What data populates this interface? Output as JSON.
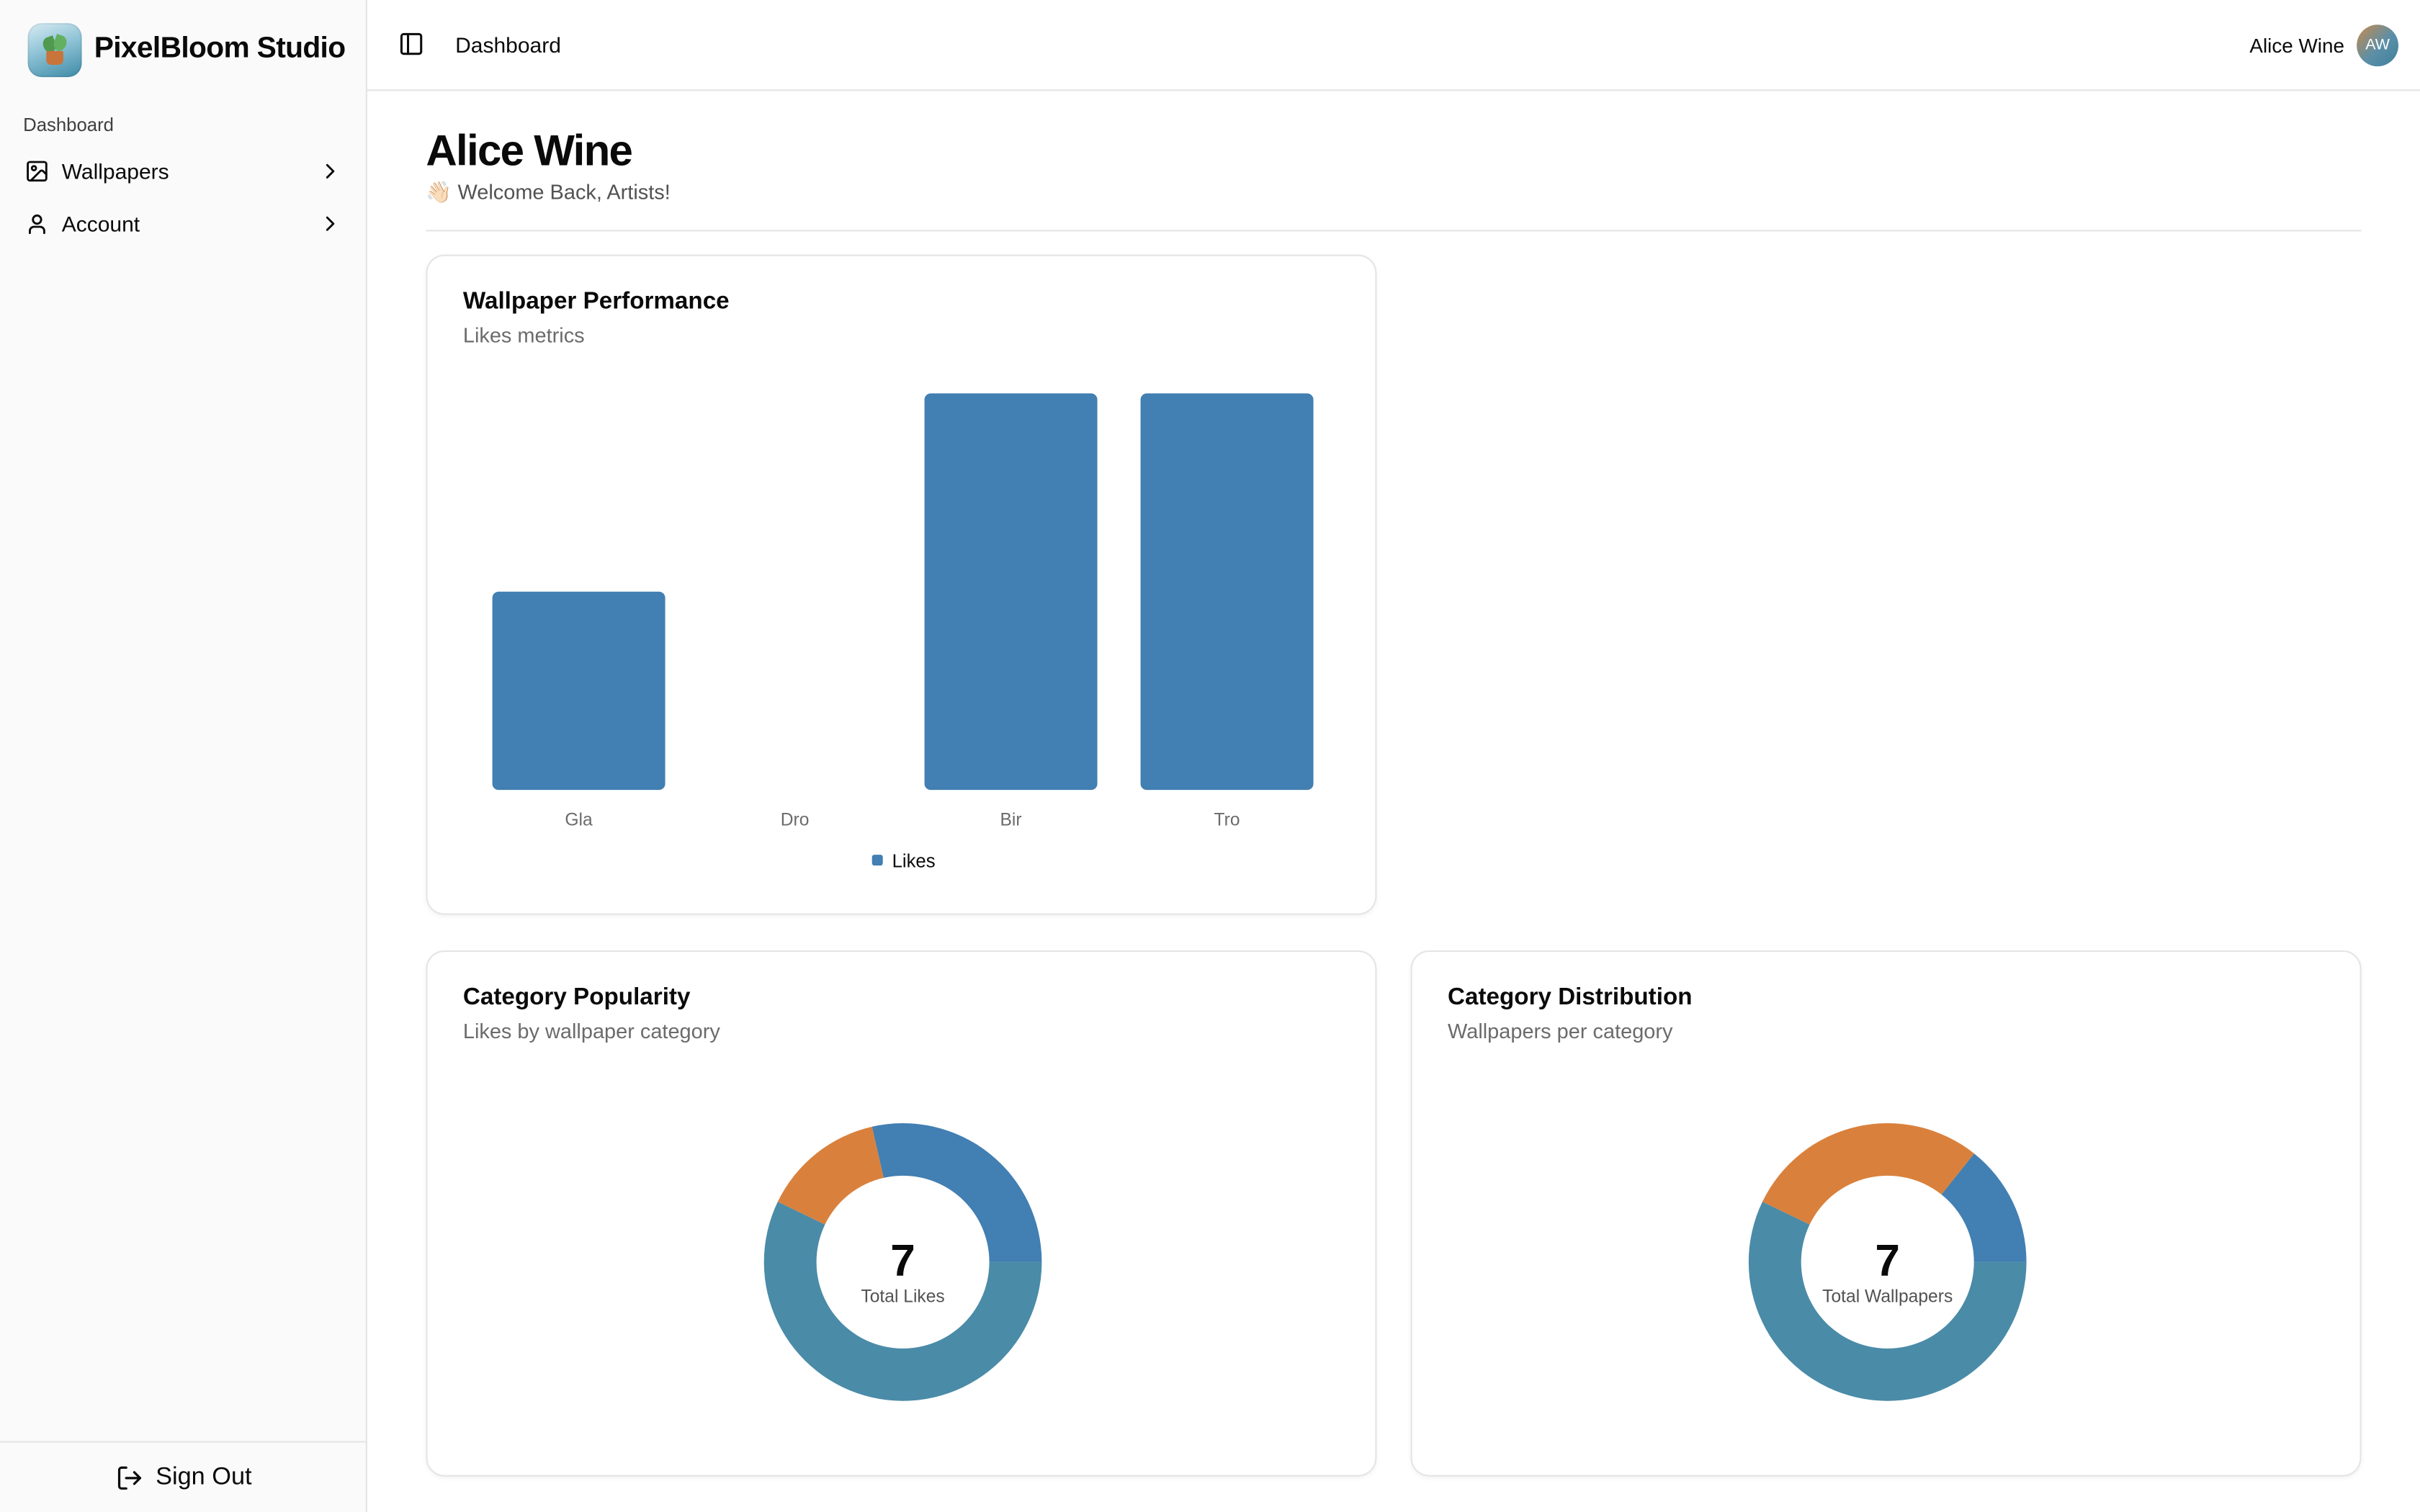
{
  "brand": {
    "name": "PixelBloom Studio",
    "logo_icon": "potted-plant-icon"
  },
  "sidebar": {
    "section_label": "Dashboard",
    "items": [
      {
        "label": "Wallpapers",
        "icon": "image-icon"
      },
      {
        "label": "Account",
        "icon": "user-icon"
      }
    ],
    "sign_out_label": "Sign Out"
  },
  "topbar": {
    "breadcrumb": "Dashboard",
    "user_name": "Alice Wine",
    "user_initials": "AW"
  },
  "page": {
    "title": "Alice Wine",
    "subtitle": "👋🏻 Welcome Back, Artists!"
  },
  "colors": {
    "primary": "#427fb2",
    "orange": "#d9813c",
    "teal": "#4a8ba8"
  },
  "cards": {
    "performance": {
      "title": "Wallpaper Performance",
      "description": "Likes metrics"
    },
    "popularity": {
      "title": "Category Popularity",
      "description": "Likes by wallpaper category"
    },
    "distribution": {
      "title": "Category Distribution",
      "description": "Wallpapers per category"
    }
  },
  "chart_data": [
    {
      "type": "bar",
      "title": "Wallpaper Performance",
      "subtitle": "Likes metrics",
      "categories": [
        "Gla",
        "Dro",
        "Bir",
        "Tro"
      ],
      "series": [
        {
          "name": "Likes",
          "values": [
            1,
            0,
            2,
            2
          ],
          "color": "#427fb2"
        }
      ],
      "ylim": [
        0,
        2
      ],
      "grid": false,
      "legend": "bottom"
    },
    {
      "type": "pie",
      "title": "Category Popularity",
      "subtitle": "Likes by wallpaper category",
      "slices": [
        {
          "value": 2,
          "color": "#427fb2"
        },
        {
          "value": 1,
          "color": "#d9813c"
        },
        {
          "value": 4,
          "color": "#4a8ba8"
        }
      ],
      "center_value": "7",
      "center_label": "Total Likes"
    },
    {
      "type": "pie",
      "title": "Category Distribution",
      "subtitle": "Wallpapers per category",
      "slices": [
        {
          "value": 1,
          "color": "#427fb2"
        },
        {
          "value": 2,
          "color": "#d9813c"
        },
        {
          "value": 4,
          "color": "#4a8ba8"
        }
      ],
      "center_value": "7",
      "center_label": "Total Wallpapers"
    }
  ]
}
